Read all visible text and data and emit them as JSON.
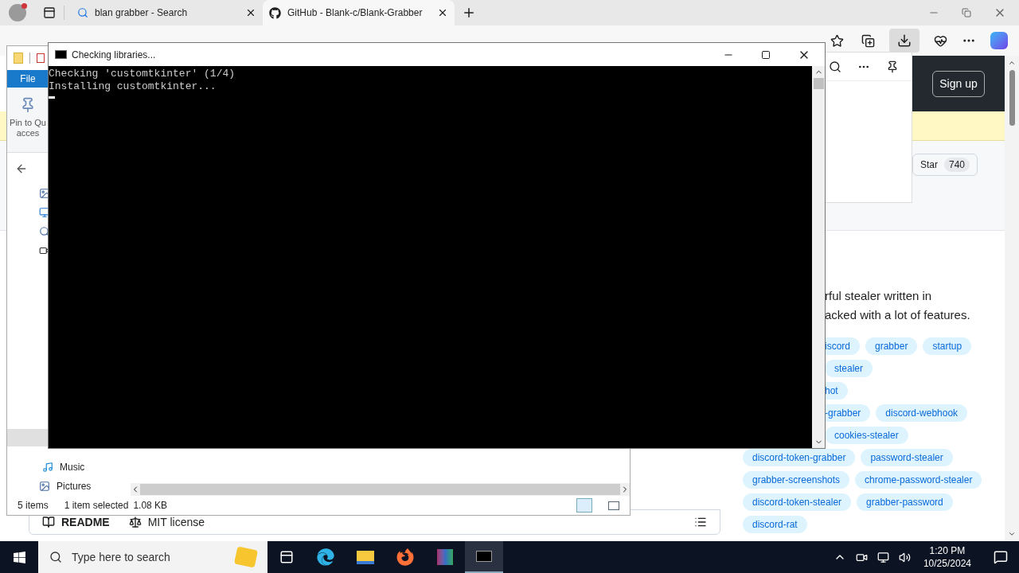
{
  "browser": {
    "tabs": [
      {
        "title": "blan grabber - Search",
        "selected": false
      },
      {
        "title": "GitHub - Blank-c/Blank-Grabber",
        "selected": true
      }
    ]
  },
  "github": {
    "sign_up": "Sign up",
    "star": {
      "label": "Star",
      "count": "740"
    },
    "description": [
      "rful stealer written in",
      "acked with a lot of features."
    ],
    "topic_rows": [
      {
        "cut": true,
        "topics": [
          "iscord",
          "grabber",
          "startup"
        ]
      },
      {
        "cut": false,
        "topics": [
          "stealer"
        ]
      },
      {
        "cut": true,
        "topics": [
          "hot"
        ]
      },
      {
        "cut": true,
        "topics": [
          "-grabber",
          "discord-webhook"
        ]
      },
      {
        "cut": false,
        "topics": [
          "cookies-stealer"
        ]
      },
      {
        "cut": false,
        "topics": [
          "discord-token-grabber",
          "password-stealer"
        ]
      },
      {
        "cut": false,
        "topics": [
          "grabber-screenshots",
          "chrome-password-stealer"
        ]
      },
      {
        "cut": false,
        "topics": [
          "discord-token-stealer",
          "grabber-password"
        ]
      },
      {
        "cut": false,
        "topics": [
          "discord-rat"
        ]
      }
    ],
    "tabs": [
      "README",
      "MIT license"
    ]
  },
  "explorer": {
    "ribbon_tab": "File",
    "pin_label": [
      "Pin to Qu",
      "acces"
    ],
    "nav_items": [
      "Music",
      "Pictures"
    ],
    "status": {
      "count": "5 items",
      "selection": "1 item selected",
      "size": "1.08 KB"
    }
  },
  "console": {
    "title": "Checking libraries...",
    "lines": [
      "Checking 'customtkinter' (1/4)",
      "Installing customtkinter..."
    ]
  },
  "taskbar": {
    "search_placeholder": "Type here to search",
    "time": "1:20 PM",
    "date": "10/25/2024"
  }
}
